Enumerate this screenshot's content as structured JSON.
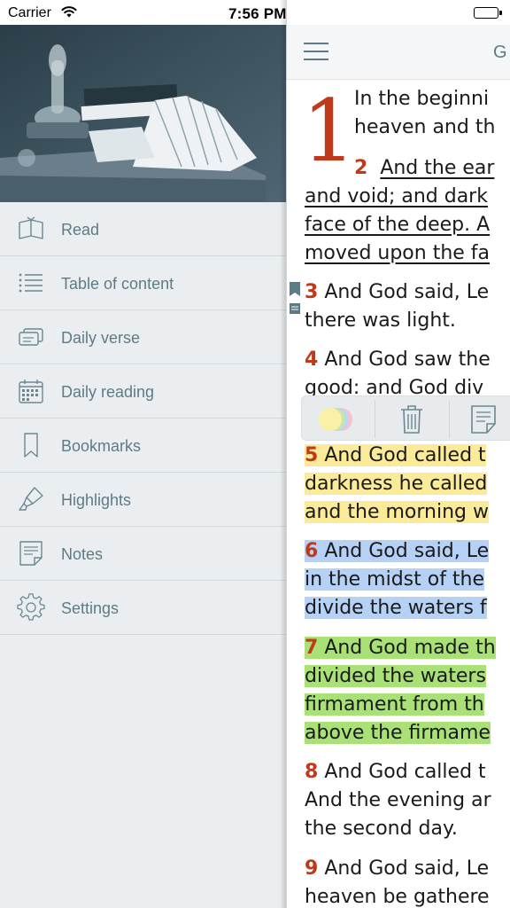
{
  "status_bar": {
    "carrier": "Carrier",
    "time": "7:56 PM"
  },
  "drawer": {
    "menu": [
      {
        "id": "read",
        "label": "Read",
        "icon": "book-icon"
      },
      {
        "id": "table-of-content",
        "label": "Table of content",
        "icon": "list-icon"
      },
      {
        "id": "daily-verse",
        "label": "Daily verse",
        "icon": "cards-icon"
      },
      {
        "id": "daily-reading",
        "label": "Daily reading",
        "icon": "calendar-icon"
      },
      {
        "id": "bookmarks",
        "label": "Bookmarks",
        "icon": "bookmark-icon"
      },
      {
        "id": "highlights",
        "label": "Highlights",
        "icon": "highlighter-icon"
      },
      {
        "id": "notes",
        "label": "Notes",
        "icon": "note-icon"
      },
      {
        "id": "settings",
        "label": "Settings",
        "icon": "gear-icon"
      }
    ]
  },
  "reader": {
    "title": "G",
    "chapter": "1",
    "lines": {
      "v1a": "In the beginni",
      "v1b": "heaven and th",
      "v2n": "2",
      "v2a": "And the ear",
      "v2b": "and void; and dark",
      "v2c": "face of the deep. A",
      "v2d": "moved upon the fa",
      "v3n": "3",
      "v3a": "And God said, Le",
      "v3b": "there was light.",
      "v4n": "4",
      "v4a": "And God saw the",
      "v4b": "good: and God div",
      "v5n": "5",
      "v5a": "And God called t",
      "v5b": "darkness he called",
      "v5c": "and the morning w",
      "v6n": "6",
      "v6a": "And God said, Le",
      "v6b": "in the midst of the",
      "v6c": "divide the waters f",
      "v7n": "7",
      "v7a": "And God made th",
      "v7b": "divided the waters",
      "v7c": "firmament from th",
      "v7d": "above the firmame",
      "v8n": "8",
      "v8a": "And God called t",
      "v8b": "And the evening ar",
      "v8c": "the second day.",
      "v9n": "9",
      "v9a": "And God said, Le",
      "v9b": "heaven be gathere"
    },
    "toolbar": {
      "tools": [
        "color-picker-icon",
        "trash-icon",
        "note-icon"
      ]
    }
  },
  "colors": {
    "accent": "#5d7b87",
    "verse_number": "#c0391b",
    "highlight_yellow": "#fbeb98",
    "highlight_blue": "#b6d1f6",
    "highlight_green": "#a9e177",
    "drawer_bg": "#ebeef0"
  }
}
